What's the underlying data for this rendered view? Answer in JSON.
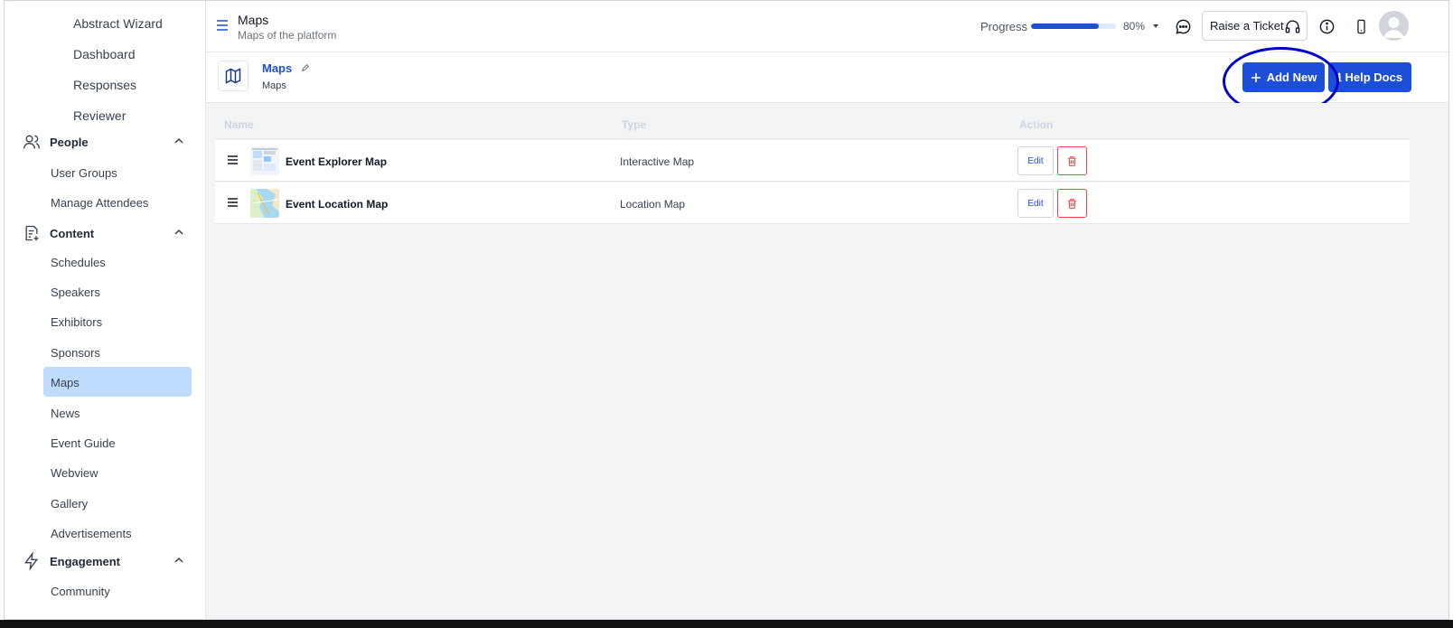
{
  "header": {
    "title": "Maps",
    "subtitle": "Maps of the platform",
    "progress_label": "Progress",
    "progress_value": 0.8,
    "progress_text": "80%",
    "ticket_label": "Raise a Ticket"
  },
  "sidebar": {
    "wizard_items": [
      "Abstract Wizard",
      "Dashboard",
      "Responses",
      "Reviewer"
    ],
    "people": {
      "label": "People",
      "items": [
        "User Groups",
        "Manage Attendees"
      ]
    },
    "content": {
      "label": "Content",
      "items": [
        "Schedules",
        "Speakers",
        "Exhibitors",
        "Sponsors",
        "Maps",
        "News",
        "Event Guide",
        "Webview",
        "Gallery",
        "Advertisements"
      ],
      "active": "Maps"
    },
    "engagement": {
      "label": "Engagement",
      "items": [
        "Community"
      ]
    }
  },
  "content_header": {
    "title": "Maps",
    "subtitle": "Maps",
    "add_label": "Add New",
    "help_label": "Help Docs"
  },
  "table": {
    "columns": [
      "Name",
      "Type",
      "Action"
    ],
    "rows": [
      {
        "name": "Event Explorer Map",
        "type": "Interactive Map",
        "edit": "Edit"
      },
      {
        "name": "Event Location Map",
        "type": "Location Map",
        "edit": "Edit"
      }
    ]
  },
  "colors": {
    "primary": "#1d4ed8",
    "active_bg": "#bfdbfe",
    "danger": "#ef4444",
    "annotation": "#0000cc"
  }
}
